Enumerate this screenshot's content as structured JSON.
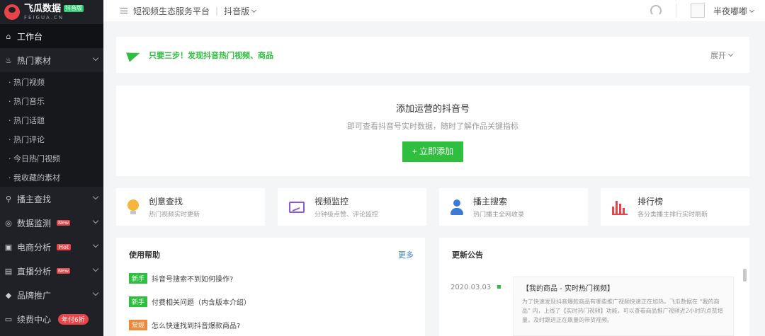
{
  "logo": {
    "title": "飞瓜数据",
    "badge": "抖音版",
    "sub": "FEIGUA.CN"
  },
  "sidebar": {
    "items": [
      {
        "label": "工作台"
      },
      {
        "label": "热门素材"
      },
      {
        "label": "播主查找"
      },
      {
        "label": "数据监测",
        "tag": "New"
      },
      {
        "label": "电商分析",
        "tag": "Hot"
      },
      {
        "label": "直播分析",
        "tag": "New"
      },
      {
        "label": "品牌推广"
      },
      {
        "label": "续费中心",
        "tag": "年付6折"
      }
    ],
    "subitems": [
      "· 热门视频",
      "· 热门音乐",
      "· 热门话题",
      "· 热门评论",
      "· 今日热门视频",
      "· 我收藏的素材"
    ]
  },
  "header": {
    "platform": "短视频生态服务平台",
    "version": "抖音版",
    "username": "半夜嘟嘟"
  },
  "banner": {
    "text": "只要三步！发现抖音热门视频、商品",
    "expand": "展开"
  },
  "add": {
    "title": "添加运营的抖音号",
    "subtitle": "即可查看抖音号实时数据，随时了解作品关键指标",
    "button": "+ 立即添加"
  },
  "features": [
    {
      "title": "创意查找",
      "sub": "热门视频实时更新"
    },
    {
      "title": "视频监控",
      "sub": "分钟级点赞、评论监控"
    },
    {
      "title": "播主搜索",
      "sub": "热门播主全网收录"
    },
    {
      "title": "排行榜",
      "sub": "各分类播主排行实时刷新"
    }
  ],
  "help": {
    "title": "使用帮助",
    "more": "更多",
    "rows": [
      {
        "badge": "新手",
        "text": "抖音号搜索不到如何操作?"
      },
      {
        "badge": "新手",
        "text": "付费相关问题（内含版本介绍）"
      },
      {
        "badge": "常规",
        "text": "怎么快速找到抖音爆款商品?"
      }
    ]
  },
  "notice": {
    "title": "更新公告",
    "date": "2020.03.03",
    "item_title": "【我的商品 - 实时热门视频】",
    "item_text": "为了快速发现抖音爆款商品有哪些推广视频快速正在加热，飞瓜数据在 “我的商品” 内，上线了【实时热门视频】功能，可以查看商品推广视频近2小时的点赞增量，及时跟进正在飙量的带货视频。"
  },
  "colors": {
    "accent": "#2ebf3f",
    "sidebar_bg": "#1f2126",
    "tag_red": "#e8454a",
    "link": "#3b7bd8"
  }
}
